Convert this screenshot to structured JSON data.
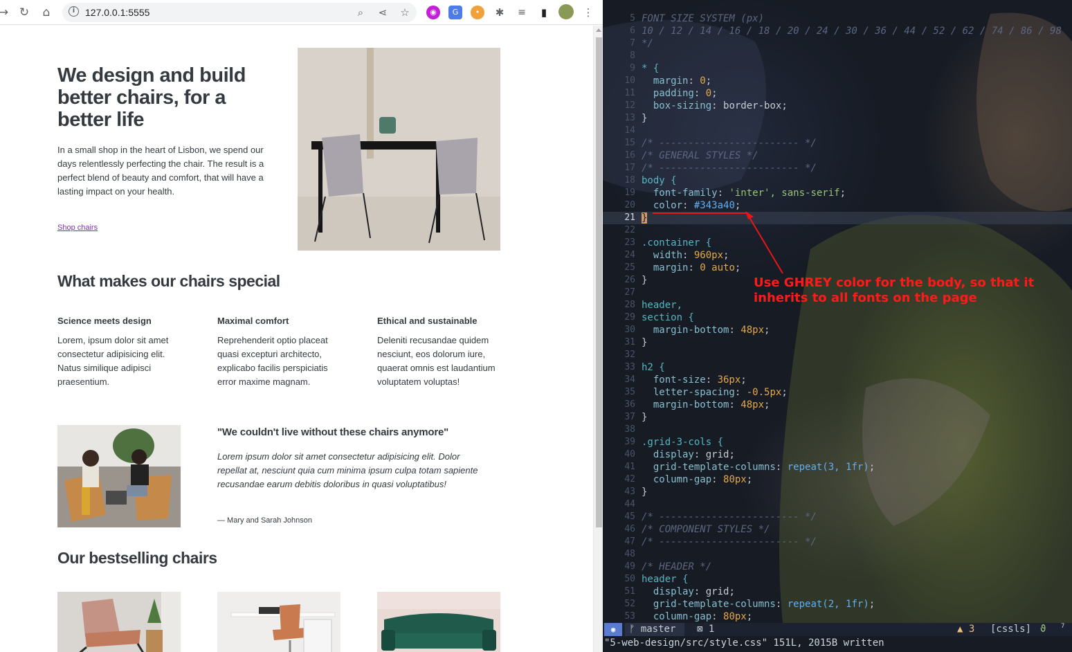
{
  "browser": {
    "url": "127.0.0.1:5555",
    "buttons": {
      "back": "→",
      "reload": "↻",
      "home": "⌂"
    },
    "omni_icons": [
      "zoom-icon",
      "share-icon",
      "bookmark-star-icon"
    ],
    "extensions": [
      "lastpass-icon",
      "translate-icon",
      "cookie-icon",
      "puzzle-icon",
      "media-queue-icon",
      "sidepanel-icon",
      "profile-avatar",
      "menu-kebab-icon"
    ]
  },
  "page": {
    "hero": {
      "title": "We design and build better chairs, for a better life",
      "text": "In a small shop in the heart of Lisbon, we spend our days relentlessly perfecting the chair. The result is a perfect blend of beauty and comfort, that will have a lasting impact on your health.",
      "link": "Shop chairs"
    },
    "features": {
      "heading": "What makes our chairs special",
      "items": [
        {
          "title": "Science meets design",
          "text": "Lorem, ipsum dolor sit amet consectetur adipisicing elit. Natus similique adipisci praesentium."
        },
        {
          "title": "Maximal comfort",
          "text": "Reprehenderit optio placeat quasi excepturi architecto, explicabo facilis perspiciatis error maxime magnam."
        },
        {
          "title": "Ethical and sustainable",
          "text": "Deleniti recusandae quidem nesciunt, eos dolorum iure, quaerat omnis est laudantium voluptatem voluptas!"
        }
      ]
    },
    "testimonial": {
      "quote_title": "\"We couldn't live without these chairs anymore\"",
      "quote": "Lorem ipsum dolor sit amet consectetur adipisicing elit. Dolor repellat at, nesciunt quia cum minima ipsum culpa totam sapiente recusandae earum debitis doloribus in quasi voluptatibus!",
      "author": "— Mary and Sarah Johnson"
    },
    "bestsellers": {
      "heading": "Our bestselling chairs"
    }
  },
  "editor": {
    "lines": [
      {
        "n": "5",
        "code": "FONT SIZE SYSTEM (px)",
        "kind": "comment"
      },
      {
        "n": "6",
        "code": "10 / 12 / 14 / 16 / 18 / 20 / 24 / 30 / 36 / 44 / 52 / 62 / 74 / 86 / 98",
        "kind": "comment"
      },
      {
        "n": "7",
        "code": "*/",
        "kind": "comment"
      },
      {
        "n": "8",
        "code": "",
        "kind": "plain"
      },
      {
        "n": "9",
        "code": "* {",
        "kind": "selector"
      },
      {
        "n": "10",
        "code": "  margin: 0;",
        "kind": "decl",
        "prop": "margin",
        "val": "0",
        "vkind": "num"
      },
      {
        "n": "11",
        "code": "  padding: 0;",
        "kind": "decl",
        "prop": "padding",
        "val": "0",
        "vkind": "num"
      },
      {
        "n": "12",
        "code": "  box-sizing: border-box;",
        "kind": "decl",
        "prop": "box-sizing",
        "val": "border-box",
        "vkind": "plain"
      },
      {
        "n": "13",
        "code": "}",
        "kind": "plain"
      },
      {
        "n": "14",
        "code": "",
        "kind": "plain"
      },
      {
        "n": "15",
        "code": "/* ------------------------ */",
        "kind": "comment"
      },
      {
        "n": "16",
        "code": "/* GENERAL STYLES */",
        "kind": "comment"
      },
      {
        "n": "17",
        "code": "/* ------------------------ */",
        "kind": "comment"
      },
      {
        "n": "18",
        "code": "body {",
        "kind": "selector"
      },
      {
        "n": "19",
        "code": "  font-family: 'inter', sans-serif;",
        "kind": "decl",
        "prop": "font-family",
        "val": "'inter', sans-serif",
        "vkind": "str"
      },
      {
        "n": "20",
        "code": "  color: #343a40;",
        "kind": "decl",
        "prop": "color",
        "val": "#343a40",
        "vkind": "fn"
      },
      {
        "n": "21",
        "code": "}",
        "kind": "cursor"
      },
      {
        "n": "22",
        "code": "",
        "kind": "plain"
      },
      {
        "n": "23",
        "code": ".container {",
        "kind": "selector"
      },
      {
        "n": "24",
        "code": "  width: 960px;",
        "kind": "decl",
        "prop": "width",
        "val": "960px",
        "vkind": "num"
      },
      {
        "n": "25",
        "code": "  margin: 0 auto;",
        "kind": "decl",
        "prop": "margin",
        "val": "0 auto",
        "vkind": "mix"
      },
      {
        "n": "26",
        "code": "}",
        "kind": "plain"
      },
      {
        "n": "27",
        "code": "",
        "kind": "plain"
      },
      {
        "n": "28",
        "code": "header,",
        "kind": "selector"
      },
      {
        "n": "29",
        "code": "section {",
        "kind": "selector"
      },
      {
        "n": "30",
        "code": "  margin-bottom: 48px;",
        "kind": "decl",
        "prop": "margin-bottom",
        "val": "48px",
        "vkind": "num"
      },
      {
        "n": "31",
        "code": "}",
        "kind": "plain"
      },
      {
        "n": "32",
        "code": "",
        "kind": "plain"
      },
      {
        "n": "33",
        "code": "h2 {",
        "kind": "selector"
      },
      {
        "n": "34",
        "code": "  font-size: 36px;",
        "kind": "decl",
        "prop": "font-size",
        "val": "36px",
        "vkind": "num"
      },
      {
        "n": "35",
        "code": "  letter-spacing: -0.5px;",
        "kind": "decl",
        "prop": "letter-spacing",
        "val": "-0.5px",
        "vkind": "num"
      },
      {
        "n": "36",
        "code": "  margin-bottom: 48px;",
        "kind": "decl",
        "prop": "margin-bottom",
        "val": "48px",
        "vkind": "num"
      },
      {
        "n": "37",
        "code": "}",
        "kind": "plain"
      },
      {
        "n": "38",
        "code": "",
        "kind": "plain"
      },
      {
        "n": "39",
        "code": ".grid-3-cols {",
        "kind": "selector"
      },
      {
        "n": "40",
        "code": "  display: grid;",
        "kind": "decl",
        "prop": "display",
        "val": "grid",
        "vkind": "plain"
      },
      {
        "n": "41",
        "code": "  grid-template-columns: repeat(3, 1fr);",
        "kind": "decl",
        "prop": "grid-template-columns",
        "val": "repeat(3, 1fr)",
        "vkind": "call"
      },
      {
        "n": "42",
        "code": "  column-gap: 80px;",
        "kind": "decl",
        "prop": "column-gap",
        "val": "80px",
        "vkind": "num"
      },
      {
        "n": "43",
        "code": "}",
        "kind": "plain"
      },
      {
        "n": "44",
        "code": "",
        "kind": "plain"
      },
      {
        "n": "45",
        "code": "/* ------------------------ */",
        "kind": "comment"
      },
      {
        "n": "46",
        "code": "/* COMPONENT STYLES */",
        "kind": "comment"
      },
      {
        "n": "47",
        "code": "/* ------------------------ */",
        "kind": "comment"
      },
      {
        "n": "48",
        "code": "",
        "kind": "plain"
      },
      {
        "n": "49",
        "code": "/* HEADER */",
        "kind": "comment"
      },
      {
        "n": "50",
        "code": "header {",
        "kind": "selector"
      },
      {
        "n": "51",
        "code": "  display: grid;",
        "kind": "decl",
        "prop": "display",
        "val": "grid",
        "vkind": "plain"
      },
      {
        "n": "52",
        "code": "  grid-template-columns: repeat(2, 1fr);",
        "kind": "decl",
        "prop": "grid-template-columns",
        "val": "repeat(2, 1fr)",
        "vkind": "call"
      },
      {
        "n": "53",
        "code": "  column-gap: 80px;",
        "kind": "decl",
        "prop": "column-gap",
        "val": "80px",
        "vkind": "num"
      }
    ],
    "annotation": "Use GHREY color for the body, so that it inherits to all fonts on the page",
    "status": {
      "mode": "◉",
      "branch": "ᚠ master",
      "diagnostics": "⊠ 1",
      "warnings": "▲ 3",
      "lsp": "[cssls]",
      "ok": "ϑ",
      "sup": "7"
    },
    "cmdline": "\"5-web-design/src/style.css\" 151L, 2015B written"
  },
  "colors": {
    "text": "#343a40",
    "link": "#7b2fb5",
    "annotation": "#ff1a1a"
  }
}
